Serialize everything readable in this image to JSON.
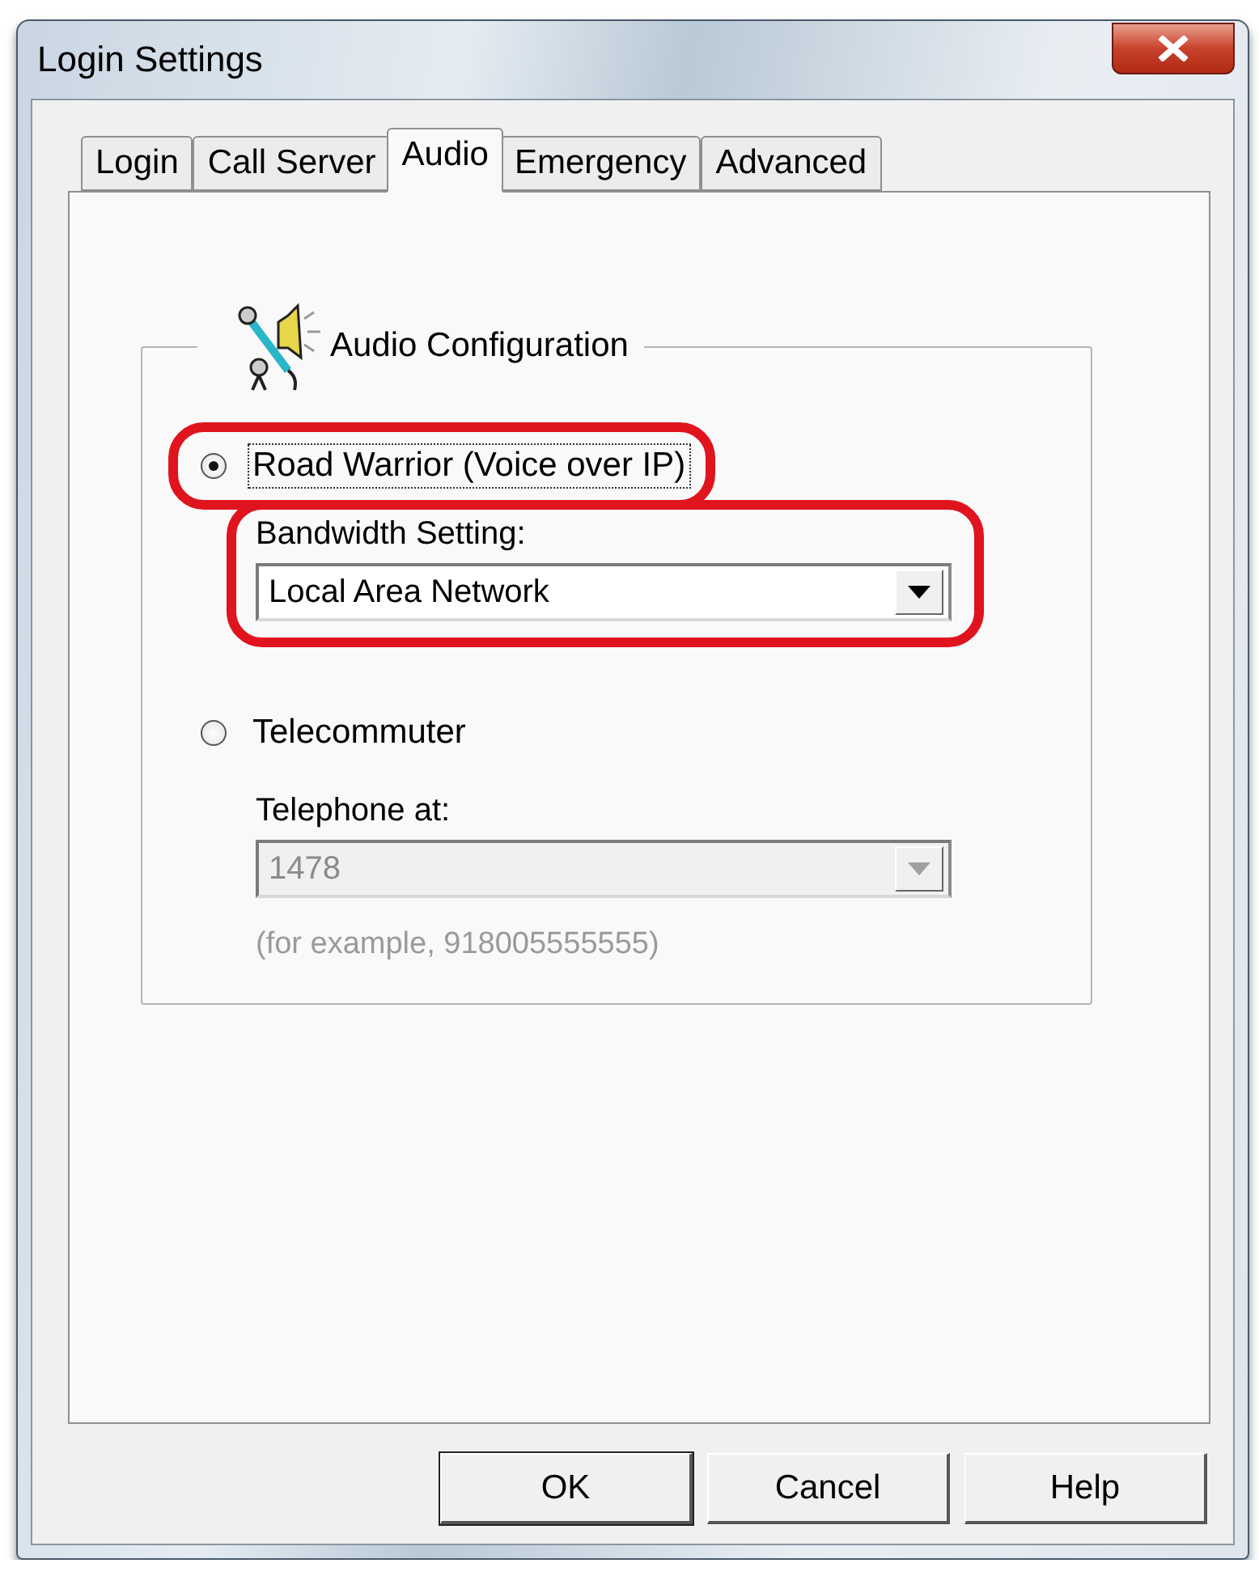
{
  "window": {
    "title": "Login Settings"
  },
  "tabs": [
    {
      "label": "Login",
      "selected": false
    },
    {
      "label": "Call Server",
      "selected": false
    },
    {
      "label": "Audio",
      "selected": true
    },
    {
      "label": "Emergency",
      "selected": false
    },
    {
      "label": "Advanced",
      "selected": false
    }
  ],
  "group": {
    "title": "Audio Configuration",
    "options": [
      {
        "label": "Road Warrior (Voice over IP)",
        "selected": true,
        "highlighted": true,
        "focused": true,
        "field_label": "Bandwidth Setting:",
        "field_value": "Local Area Network",
        "field_disabled": false,
        "field_highlighted": true
      },
      {
        "label": "Telecommuter",
        "selected": false,
        "highlighted": false,
        "focused": false,
        "field_label": "Telephone at:",
        "field_value": "1478",
        "field_disabled": true,
        "field_highlighted": false,
        "hint": "(for example, 918005555555)"
      }
    ]
  },
  "buttons": [
    {
      "label": "OK",
      "default": true
    },
    {
      "label": "Cancel",
      "default": false
    },
    {
      "label": "Help",
      "default": false
    }
  ]
}
